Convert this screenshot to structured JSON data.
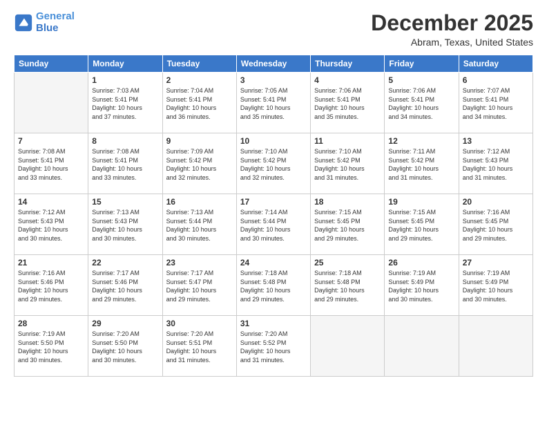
{
  "header": {
    "logo_line1": "General",
    "logo_line2": "Blue",
    "month": "December 2025",
    "location": "Abram, Texas, United States"
  },
  "days_of_week": [
    "Sunday",
    "Monday",
    "Tuesday",
    "Wednesday",
    "Thursday",
    "Friday",
    "Saturday"
  ],
  "weeks": [
    [
      {
        "day": "",
        "info": ""
      },
      {
        "day": "1",
        "info": "Sunrise: 7:03 AM\nSunset: 5:41 PM\nDaylight: 10 hours\nand 37 minutes."
      },
      {
        "day": "2",
        "info": "Sunrise: 7:04 AM\nSunset: 5:41 PM\nDaylight: 10 hours\nand 36 minutes."
      },
      {
        "day": "3",
        "info": "Sunrise: 7:05 AM\nSunset: 5:41 PM\nDaylight: 10 hours\nand 35 minutes."
      },
      {
        "day": "4",
        "info": "Sunrise: 7:06 AM\nSunset: 5:41 PM\nDaylight: 10 hours\nand 35 minutes."
      },
      {
        "day": "5",
        "info": "Sunrise: 7:06 AM\nSunset: 5:41 PM\nDaylight: 10 hours\nand 34 minutes."
      },
      {
        "day": "6",
        "info": "Sunrise: 7:07 AM\nSunset: 5:41 PM\nDaylight: 10 hours\nand 34 minutes."
      }
    ],
    [
      {
        "day": "7",
        "info": "Sunrise: 7:08 AM\nSunset: 5:41 PM\nDaylight: 10 hours\nand 33 minutes."
      },
      {
        "day": "8",
        "info": "Sunrise: 7:08 AM\nSunset: 5:41 PM\nDaylight: 10 hours\nand 33 minutes."
      },
      {
        "day": "9",
        "info": "Sunrise: 7:09 AM\nSunset: 5:42 PM\nDaylight: 10 hours\nand 32 minutes."
      },
      {
        "day": "10",
        "info": "Sunrise: 7:10 AM\nSunset: 5:42 PM\nDaylight: 10 hours\nand 32 minutes."
      },
      {
        "day": "11",
        "info": "Sunrise: 7:10 AM\nSunset: 5:42 PM\nDaylight: 10 hours\nand 31 minutes."
      },
      {
        "day": "12",
        "info": "Sunrise: 7:11 AM\nSunset: 5:42 PM\nDaylight: 10 hours\nand 31 minutes."
      },
      {
        "day": "13",
        "info": "Sunrise: 7:12 AM\nSunset: 5:43 PM\nDaylight: 10 hours\nand 31 minutes."
      }
    ],
    [
      {
        "day": "14",
        "info": "Sunrise: 7:12 AM\nSunset: 5:43 PM\nDaylight: 10 hours\nand 30 minutes."
      },
      {
        "day": "15",
        "info": "Sunrise: 7:13 AM\nSunset: 5:43 PM\nDaylight: 10 hours\nand 30 minutes."
      },
      {
        "day": "16",
        "info": "Sunrise: 7:13 AM\nSunset: 5:44 PM\nDaylight: 10 hours\nand 30 minutes."
      },
      {
        "day": "17",
        "info": "Sunrise: 7:14 AM\nSunset: 5:44 PM\nDaylight: 10 hours\nand 30 minutes."
      },
      {
        "day": "18",
        "info": "Sunrise: 7:15 AM\nSunset: 5:45 PM\nDaylight: 10 hours\nand 29 minutes."
      },
      {
        "day": "19",
        "info": "Sunrise: 7:15 AM\nSunset: 5:45 PM\nDaylight: 10 hours\nand 29 minutes."
      },
      {
        "day": "20",
        "info": "Sunrise: 7:16 AM\nSunset: 5:45 PM\nDaylight: 10 hours\nand 29 minutes."
      }
    ],
    [
      {
        "day": "21",
        "info": "Sunrise: 7:16 AM\nSunset: 5:46 PM\nDaylight: 10 hours\nand 29 minutes."
      },
      {
        "day": "22",
        "info": "Sunrise: 7:17 AM\nSunset: 5:46 PM\nDaylight: 10 hours\nand 29 minutes."
      },
      {
        "day": "23",
        "info": "Sunrise: 7:17 AM\nSunset: 5:47 PM\nDaylight: 10 hours\nand 29 minutes."
      },
      {
        "day": "24",
        "info": "Sunrise: 7:18 AM\nSunset: 5:48 PM\nDaylight: 10 hours\nand 29 minutes."
      },
      {
        "day": "25",
        "info": "Sunrise: 7:18 AM\nSunset: 5:48 PM\nDaylight: 10 hours\nand 29 minutes."
      },
      {
        "day": "26",
        "info": "Sunrise: 7:19 AM\nSunset: 5:49 PM\nDaylight: 10 hours\nand 30 minutes."
      },
      {
        "day": "27",
        "info": "Sunrise: 7:19 AM\nSunset: 5:49 PM\nDaylight: 10 hours\nand 30 minutes."
      }
    ],
    [
      {
        "day": "28",
        "info": "Sunrise: 7:19 AM\nSunset: 5:50 PM\nDaylight: 10 hours\nand 30 minutes."
      },
      {
        "day": "29",
        "info": "Sunrise: 7:20 AM\nSunset: 5:50 PM\nDaylight: 10 hours\nand 30 minutes."
      },
      {
        "day": "30",
        "info": "Sunrise: 7:20 AM\nSunset: 5:51 PM\nDaylight: 10 hours\nand 31 minutes."
      },
      {
        "day": "31",
        "info": "Sunrise: 7:20 AM\nSunset: 5:52 PM\nDaylight: 10 hours\nand 31 minutes."
      },
      {
        "day": "",
        "info": ""
      },
      {
        "day": "",
        "info": ""
      },
      {
        "day": "",
        "info": ""
      }
    ]
  ]
}
